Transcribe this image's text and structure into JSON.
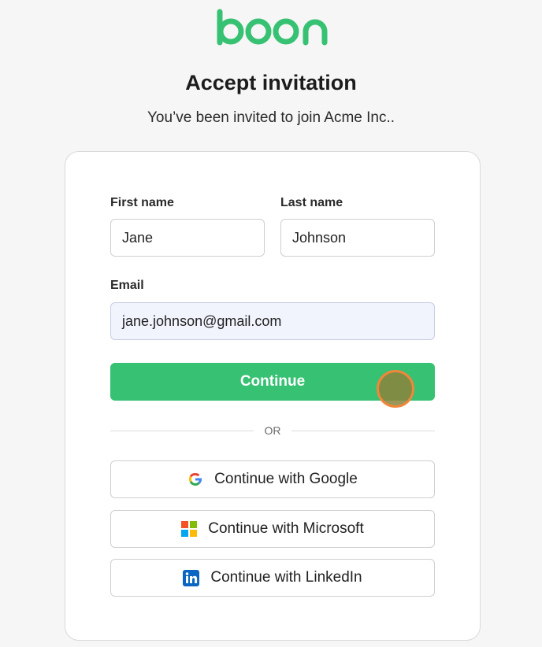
{
  "brand": {
    "logo_text": "boon",
    "color": "#37c173"
  },
  "header": {
    "title": "Accept invitation",
    "subtitle": "You’ve been invited to join Acme Inc.."
  },
  "form": {
    "first_name": {
      "label": "First name",
      "value": "Jane"
    },
    "last_name": {
      "label": "Last name",
      "value": "Johnson"
    },
    "email": {
      "label": "Email",
      "value": "jane.johnson@gmail.com"
    },
    "continue_label": "Continue",
    "divider_text": "OR"
  },
  "social": [
    {
      "label": "Continue with Google",
      "icon": "google-icon"
    },
    {
      "label": "Continue with Microsoft",
      "icon": "microsoft-icon"
    },
    {
      "label": "Continue with LinkedIn",
      "icon": "linkedin-icon"
    }
  ],
  "colors": {
    "primary": "#37c173",
    "background": "#f6f6f6",
    "email_field_bg": "#f2f4fd"
  }
}
